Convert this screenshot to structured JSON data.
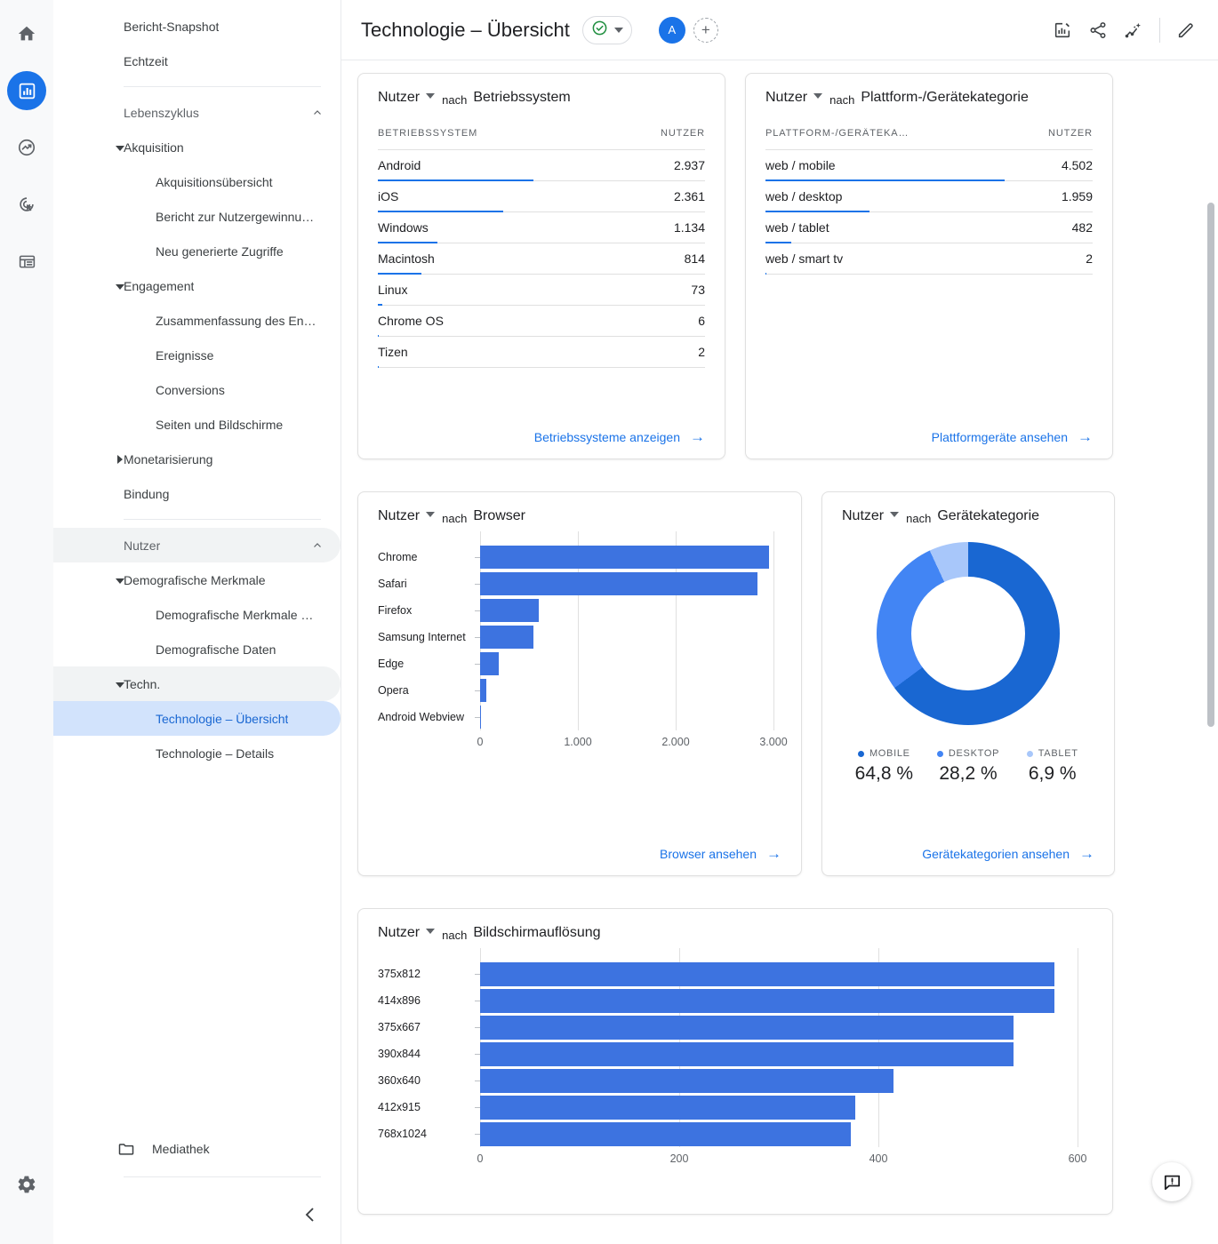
{
  "rail": {
    "icons": [
      {
        "name": "home-icon",
        "label": "Startseite"
      },
      {
        "name": "reports-bar-chart-icon",
        "label": "Berichte",
        "active": true
      },
      {
        "name": "explore-trending-icon",
        "label": "Explorative Datenanalyse"
      },
      {
        "name": "advertising-target-icon",
        "label": "Werbung"
      },
      {
        "name": "configure-list-icon",
        "label": "Konfigurieren"
      }
    ],
    "settings_label": "Verwaltung"
  },
  "sidebar": {
    "items": [
      {
        "label": "Bericht-Snapshot",
        "level": "top"
      },
      {
        "label": "Echtzeit",
        "level": "top"
      },
      {
        "label": "Lebenszyklus",
        "level": "group",
        "expanded": true
      },
      {
        "label": "Akquisition",
        "level": "parent",
        "expanded": true
      },
      {
        "label": "Akquisitionsübersicht",
        "level": "child"
      },
      {
        "label": "Bericht zur Nutzergewinnu…",
        "level": "child"
      },
      {
        "label": "Neu generierte Zugriffe",
        "level": "child"
      },
      {
        "label": "Engagement",
        "level": "parent",
        "expanded": true
      },
      {
        "label": "Zusammenfassung des En…",
        "level": "child"
      },
      {
        "label": "Ereignisse",
        "level": "child"
      },
      {
        "label": "Conversions",
        "level": "child"
      },
      {
        "label": "Seiten und Bildschirme",
        "level": "child"
      },
      {
        "label": "Monetarisierung",
        "level": "parent",
        "expanded": false
      },
      {
        "label": "Bindung",
        "level": "top-indent"
      },
      {
        "label": "Nutzer",
        "level": "group",
        "expanded": true
      },
      {
        "label": "Demografische Merkmale",
        "level": "parent",
        "expanded": true
      },
      {
        "label": "Demografische Merkmale …",
        "level": "child"
      },
      {
        "label": "Demografische Daten",
        "level": "child"
      },
      {
        "label": "Techn.",
        "level": "parent",
        "expanded": true,
        "parent_selected": true
      },
      {
        "label": "Technologie – Übersicht",
        "level": "child",
        "selected": true
      },
      {
        "label": "Technologie – Details",
        "level": "child"
      }
    ],
    "media_library": "Mediathek",
    "collapse_label": "Navigation minimieren"
  },
  "header": {
    "title": "Technologie – Übersicht",
    "status_icon": "check-circle-icon",
    "avatar_initial": "A",
    "add_user_label": "+",
    "actions": [
      {
        "name": "insights-edit-icon",
        "label": "Bericht anpassen"
      },
      {
        "name": "share-icon",
        "label": "Teilen"
      },
      {
        "name": "insights-sparkle-icon",
        "label": "Statistiken"
      },
      {
        "name": "edit-pencil-icon",
        "label": "Bearbeiten"
      }
    ]
  },
  "cards": {
    "os": {
      "metric": "Nutzer",
      "by": "nach",
      "dimension": "Betriebssystem",
      "columns": [
        "BETRIEBSSYSTEM",
        "NUTZER"
      ],
      "rows": [
        {
          "label": "Android",
          "value": "2.937",
          "num": 2937
        },
        {
          "label": "iOS",
          "value": "2.361",
          "num": 2361
        },
        {
          "label": "Windows",
          "value": "1.134",
          "num": 1134
        },
        {
          "label": "Macintosh",
          "value": "814",
          "num": 814
        },
        {
          "label": "Linux",
          "value": "73",
          "num": 73
        },
        {
          "label": "Chrome OS",
          "value": "6",
          "num": 6
        },
        {
          "label": "Tizen",
          "value": "2",
          "num": 2
        }
      ],
      "link": "Betriebssysteme anzeigen"
    },
    "platform": {
      "metric": "Nutzer",
      "by": "nach",
      "dimension": "Plattform-/Gerätekategorie",
      "columns": [
        "PLATTFORM-/GERÄTEKA…",
        "NUTZER"
      ],
      "rows": [
        {
          "label": "web / mobile",
          "value": "4.502",
          "num": 4502
        },
        {
          "label": "web / desktop",
          "value": "1.959",
          "num": 1959
        },
        {
          "label": "web / tablet",
          "value": "482",
          "num": 482
        },
        {
          "label": "web / smart tv",
          "value": "2",
          "num": 2
        }
      ],
      "link": "Plattformgeräte ansehen"
    },
    "browser": {
      "metric": "Nutzer",
      "by": "nach",
      "dimension": "Browser",
      "link": "Browser ansehen"
    },
    "device": {
      "metric": "Nutzer",
      "by": "nach",
      "dimension": "Gerätekategorie",
      "link": "Gerätekategorien ansehen"
    },
    "resolution": {
      "metric": "Nutzer",
      "by": "nach",
      "dimension": "Bildschirmauflösung"
    }
  },
  "feedback": {
    "icon": "feedback-bubble-icon",
    "label": "Feedback senden"
  },
  "colors": {
    "accent": "#1a73e8",
    "bar": "#3d73e0",
    "donut_mobile": "#1967d2",
    "donut_desktop": "#4285f4",
    "donut_tablet": "#a8c7fa",
    "selected_bg": "#d2e3fc",
    "selected_text": "#1967d2"
  },
  "chart_data": [
    {
      "id": "browser",
      "type": "bar",
      "orientation": "horizontal",
      "title": "Nutzer nach Browser",
      "xlabel": "",
      "ylabel": "",
      "categories": [
        "Chrome",
        "Safari",
        "Firefox",
        "Samsung Internet",
        "Edge",
        "Opera",
        "Android Webview"
      ],
      "values": [
        2955,
        2840,
        600,
        545,
        190,
        65,
        5
      ],
      "xlim": [
        0,
        3000
      ],
      "xticks": [
        0,
        1000,
        2000,
        3000
      ],
      "xticklabels": [
        "0",
        "1.000",
        "2.000",
        "3.000"
      ],
      "grid": true,
      "legend": "none"
    },
    {
      "id": "device-category",
      "type": "pie",
      "variant": "donut",
      "title": "Nutzer nach Gerätekategorie",
      "labels": [
        "MOBILE",
        "DESKTOP",
        "TABLET"
      ],
      "values": [
        64.8,
        28.2,
        6.9
      ],
      "value_labels": [
        "64,8 %",
        "28,2 %",
        "6,9 %"
      ],
      "colors": [
        "#1967d2",
        "#4285f4",
        "#a8c7fa"
      ],
      "legend": "bottom"
    },
    {
      "id": "screen-resolution",
      "type": "bar",
      "orientation": "horizontal",
      "title": "Nutzer nach Bildschirmauflösung",
      "xlabel": "",
      "ylabel": "",
      "categories": [
        "375x812",
        "414x896",
        "375x667",
        "390x844",
        "360x640",
        "412x915",
        "768x1024"
      ],
      "values": [
        577,
        577,
        536,
        536,
        415,
        377,
        372
      ],
      "xlim": [
        0,
        600
      ],
      "xticks": [
        0,
        200,
        400,
        600
      ],
      "xticklabels": [
        "0",
        "200",
        "400",
        "600"
      ],
      "grid": true,
      "legend": "none"
    },
    {
      "id": "os-table",
      "type": "table",
      "title": "Nutzer nach Betriebssystem",
      "columns": [
        "BETRIEBSSYSTEM",
        "NUTZER"
      ],
      "rows": [
        [
          "Android",
          2937
        ],
        [
          "iOS",
          2361
        ],
        [
          "Windows",
          1134
        ],
        [
          "Macintosh",
          814
        ],
        [
          "Linux",
          73
        ],
        [
          "Chrome OS",
          6
        ],
        [
          "Tizen",
          2
        ]
      ]
    },
    {
      "id": "platform-table",
      "type": "table",
      "title": "Nutzer nach Plattform-/Gerätekategorie",
      "columns": [
        "PLATTFORM-/GERÄTEKA…",
        "NUTZER"
      ],
      "rows": [
        [
          "web / mobile",
          4502
        ],
        [
          "web / desktop",
          1959
        ],
        [
          "web / tablet",
          482
        ],
        [
          "web / smart tv",
          2
        ]
      ]
    }
  ]
}
